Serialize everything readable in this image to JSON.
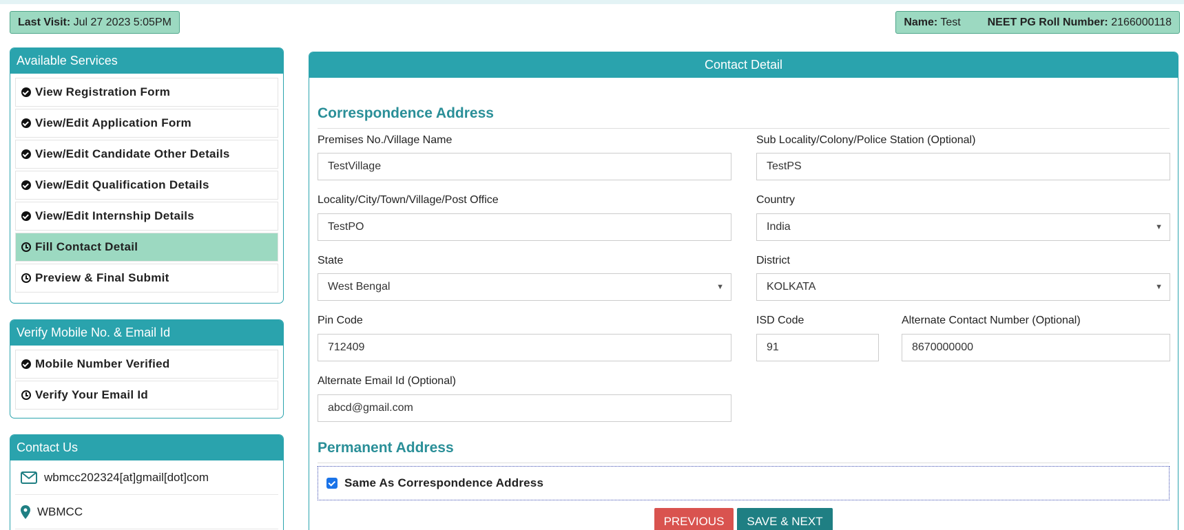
{
  "header": {
    "last_visit_label": "Last Visit:",
    "last_visit_value": "Jul 27 2023 5:05PM",
    "name_label": "Name:",
    "name_value": "Test",
    "roll_label": "NEET PG Roll Number:",
    "roll_value": "2166000118"
  },
  "services": {
    "title": "Available Services",
    "items": [
      {
        "label": "View Registration Form",
        "icon": "check-circle-icon"
      },
      {
        "label": "View/Edit Application Form",
        "icon": "check-circle-icon"
      },
      {
        "label": "View/Edit Candidate Other Details",
        "icon": "check-circle-icon"
      },
      {
        "label": "View/Edit Qualification Details",
        "icon": "check-circle-icon"
      },
      {
        "label": "View/Edit Internship Details",
        "icon": "check-circle-icon"
      },
      {
        "label": "Fill Contact Detail",
        "icon": "clock-icon"
      },
      {
        "label": "Preview & Final Submit",
        "icon": "clock-icon"
      }
    ]
  },
  "verify": {
    "title": "Verify Mobile No. & Email Id",
    "items": [
      {
        "label": "Mobile Number Verified",
        "icon": "check-circle-icon"
      },
      {
        "label": "Verify Your Email Id",
        "icon": "clock-icon"
      }
    ]
  },
  "contact": {
    "title": "Contact Us",
    "email": "wbmcc202324[at]gmail[dot]com",
    "org": "WBMCC"
  },
  "main": {
    "title": "Contact Detail",
    "correspondence_title": "Correspondence Address",
    "permanent_title": "Permanent Address",
    "fields": {
      "premises": {
        "label": "Premises No./Village Name",
        "value": "TestVillage"
      },
      "sublocality": {
        "label": "Sub Locality/Colony/Police Station (Optional)",
        "value": "TestPS"
      },
      "locality": {
        "label": "Locality/City/Town/Village/Post Office",
        "value": "TestPO"
      },
      "country": {
        "label": "Country",
        "value": "India"
      },
      "state": {
        "label": "State",
        "value": "West Bengal"
      },
      "district": {
        "label": "District",
        "value": "KOLKATA"
      },
      "pincode": {
        "label": "Pin Code",
        "value": "712409"
      },
      "isd": {
        "label": "ISD Code",
        "value": "91"
      },
      "alt_contact": {
        "label": "Alternate Contact Number (Optional)",
        "value": "8670000000"
      },
      "alt_email": {
        "label": "Alternate Email Id (Optional)",
        "value": "abcd@gmail.com"
      }
    },
    "same_as_label": "Same As Correspondence Address",
    "same_as_checked": true,
    "prev_label": "PREVIOUS",
    "next_label": "SAVE & NEXT"
  },
  "colors": {
    "teal": "#2aa3ad",
    "green_badge": "#9cd9c1",
    "section_title": "#2a8f98",
    "prev_button": "#d9534f",
    "next_button": "#1f7f83"
  }
}
